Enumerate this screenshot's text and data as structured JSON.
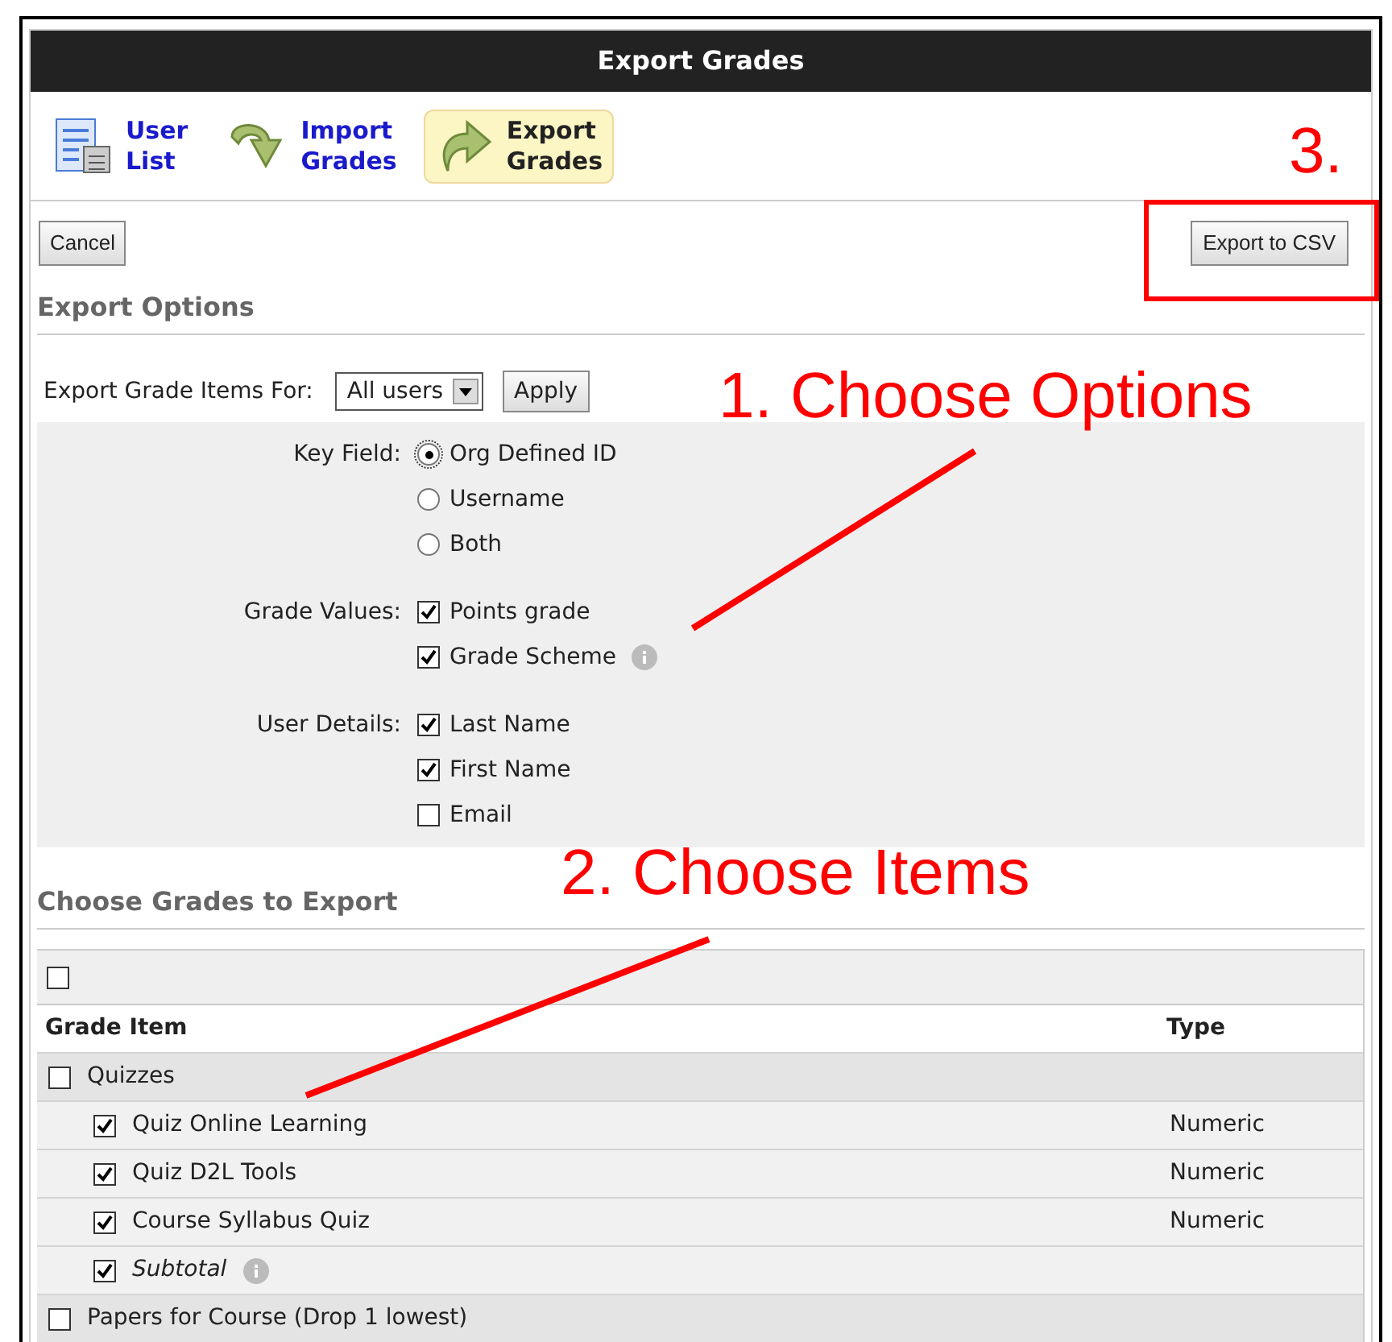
{
  "window": {
    "title": "Export Grades"
  },
  "nav": [
    {
      "label": [
        "User",
        "List"
      ],
      "selected": false
    },
    {
      "label": [
        "Import",
        "Grades"
      ],
      "selected": false
    },
    {
      "label": [
        "Export",
        "Grades"
      ],
      "selected": true
    }
  ],
  "toolbar": {
    "cancel": "Cancel",
    "export": "Export to CSV"
  },
  "export_options": {
    "heading": "Export Options",
    "for_label": "Export Grade Items For:",
    "for_value": "All users",
    "apply": "Apply",
    "groups": [
      {
        "label": "Key Field:",
        "kind": "radio",
        "options": [
          {
            "label": "Org Defined ID",
            "selected": true,
            "info": false
          },
          {
            "label": "Username",
            "selected": false,
            "info": false
          },
          {
            "label": "Both",
            "selected": false,
            "info": false
          }
        ]
      },
      {
        "label": "Grade Values:",
        "kind": "checkbox",
        "options": [
          {
            "label": "Points grade",
            "selected": true,
            "info": false
          },
          {
            "label": "Grade Scheme",
            "selected": true,
            "info": true
          }
        ]
      },
      {
        "label": "User Details:",
        "kind": "checkbox",
        "options": [
          {
            "label": "Last Name",
            "selected": true,
            "info": false
          },
          {
            "label": "First Name",
            "selected": true,
            "info": false
          },
          {
            "label": "Email",
            "selected": false,
            "info": false
          }
        ]
      }
    ]
  },
  "grades": {
    "heading": "Choose Grades to Export",
    "select_all": {
      "checked": false
    },
    "columns": [
      "Grade Item",
      "Type"
    ],
    "rows": [
      {
        "name": "Quizzes",
        "kind": "category",
        "checked": false,
        "children": [
          {
            "name": "Quiz Online Learning",
            "kind": "item",
            "type": "Numeric",
            "checked": true
          },
          {
            "name": "Quiz D2L Tools",
            "kind": "item",
            "type": "Numeric",
            "checked": true
          },
          {
            "name": "Course Syllabus Quiz",
            "kind": "item",
            "type": "Numeric",
            "checked": true
          },
          {
            "name": "Subtotal",
            "kind": "subtotal",
            "checked": true,
            "info": true
          }
        ]
      },
      {
        "name": "Papers for Course (Drop 1 lowest)",
        "kind": "category",
        "checked": false,
        "children": []
      }
    ]
  },
  "annotations": [
    {
      "text": "1. Choose Options"
    },
    {
      "text": "2. Choose Items"
    },
    {
      "text": "3."
    }
  ]
}
